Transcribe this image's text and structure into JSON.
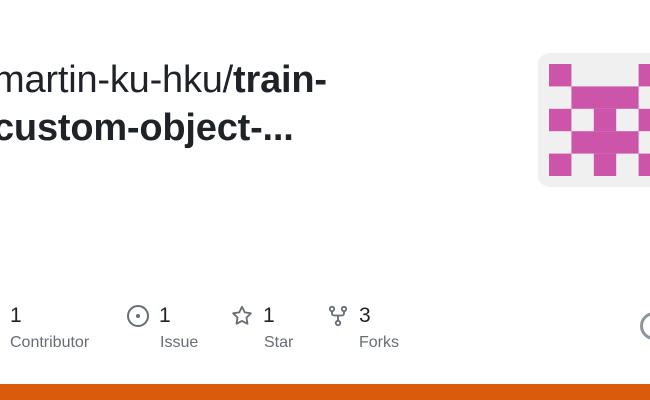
{
  "repo": {
    "owner": "martin-ku-hku/",
    "name_part1": "train-",
    "name_part2_bold": "custom-object",
    "name_part2_suffix": "-..."
  },
  "stats": [
    {
      "icon": "people-icon",
      "value": "1",
      "label": "Contributor"
    },
    {
      "icon": "issue-opened-icon",
      "value": "1",
      "label": "Issue"
    },
    {
      "icon": "star-icon",
      "value": "1",
      "label": "Star"
    },
    {
      "icon": "repo-forked-icon",
      "value": "3",
      "label": "Forks"
    }
  ],
  "colors": {
    "avatar_primary": "#cc55aa",
    "avatar_background": "#f0f0f0",
    "language_bar": "#da5b0b",
    "text_primary": "#1f2328",
    "text_secondary": "#656d76"
  },
  "language_bar": {
    "segments": [
      {
        "color": "#da5b0b",
        "fraction": 1.0
      }
    ]
  }
}
